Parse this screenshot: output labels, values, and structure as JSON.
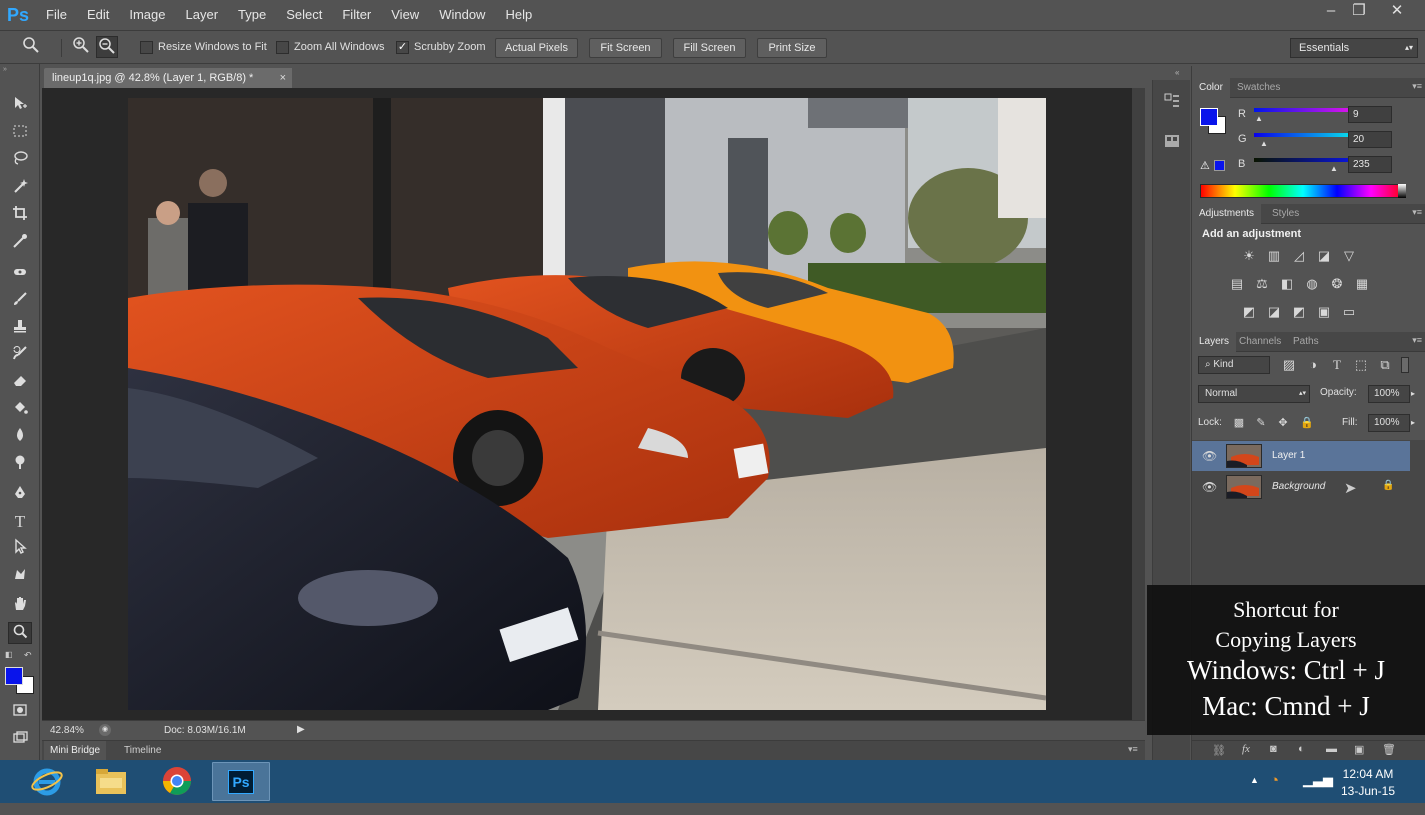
{
  "app": {
    "logo": "Ps",
    "title": "Adobe Photoshop"
  },
  "menu": [
    "File",
    "Edit",
    "Image",
    "Layer",
    "Type",
    "Select",
    "Filter",
    "View",
    "Window",
    "Help"
  ],
  "window_controls": {
    "minimize": "–",
    "restore": "❐",
    "close": "✕"
  },
  "options": {
    "resize_windows": {
      "label": "Resize Windows to Fit",
      "checked": false
    },
    "zoom_all": {
      "label": "Zoom All Windows",
      "checked": false
    },
    "scrubby_zoom": {
      "label": "Scrubby Zoom",
      "checked": true
    },
    "buttons": [
      "Actual Pixels",
      "Fit Screen",
      "Fill Screen",
      "Print Size"
    ],
    "workspace": "Essentials"
  },
  "document": {
    "tab_title": "lineup1q.jpg @ 42.8% (Layer 1, RGB/8) *",
    "close": "×"
  },
  "status": {
    "zoom": "42.84%",
    "doc": "Doc: 8.03M/16.1M"
  },
  "bottom_tabs": [
    "Mini Bridge",
    "Timeline"
  ],
  "color_panel": {
    "tabs": [
      "Color",
      "Swatches"
    ],
    "channels": [
      {
        "label": "R",
        "value": "9"
      },
      {
        "label": "G",
        "value": "20"
      },
      {
        "label": "B",
        "value": "235"
      }
    ],
    "foreground": "#0914eb",
    "background": "#ffffff"
  },
  "adjustments_panel": {
    "tabs": [
      "Adjustments",
      "Styles"
    ],
    "heading": "Add an adjustment"
  },
  "layers_panel": {
    "tabs": [
      "Layers",
      "Channels",
      "Paths"
    ],
    "filter": "Kind",
    "blend_mode": "Normal",
    "opacity_label": "Opacity:",
    "opacity": "100%",
    "lock_label": "Lock:",
    "fill_label": "Fill:",
    "fill": "100%",
    "layers": [
      {
        "name": "Layer 1",
        "selected": true
      },
      {
        "name": "Background",
        "selected": false,
        "locked": true
      }
    ]
  },
  "overlay": {
    "lines": [
      "Shortcut for",
      "Copying Layers",
      "Windows: Ctrl + J",
      "Mac: Cmnd + J"
    ]
  },
  "taskbar": {
    "time": "12:04 AM",
    "date": "13-Jun-15"
  },
  "colors": {
    "accent": "#31a8ff",
    "selection": "#5a7499",
    "taskbar": "#1f4e74"
  }
}
